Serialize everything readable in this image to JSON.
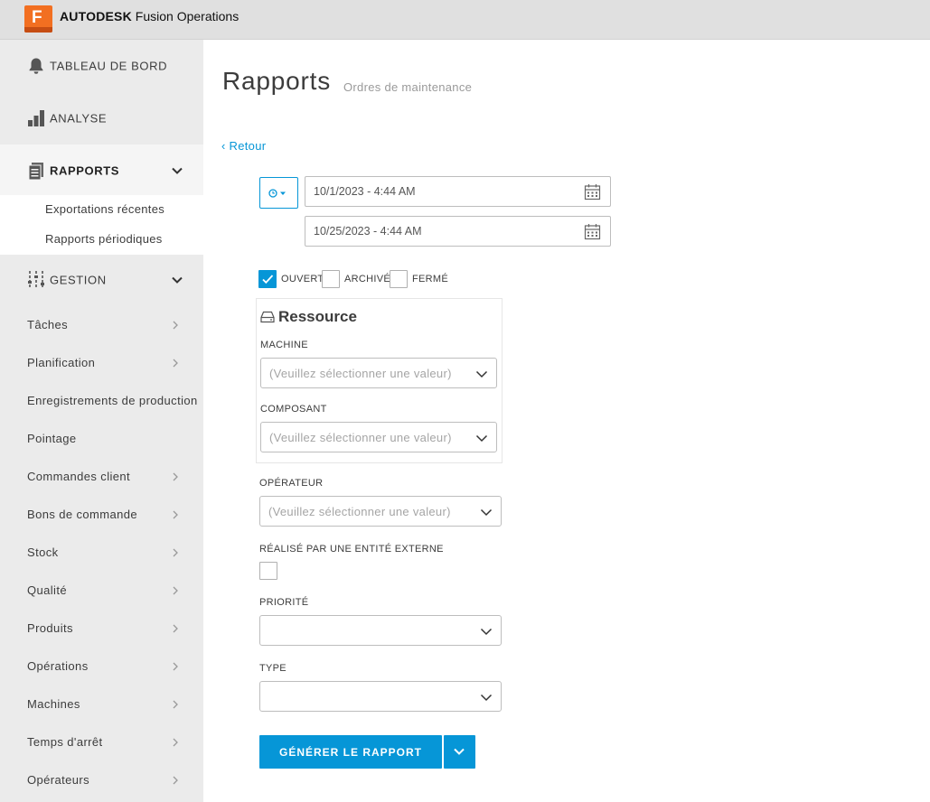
{
  "app": {
    "logo_letter": "F",
    "brand_main": "AUTODESK",
    "brand_sub": "Fusion Operations",
    "accent_color": "#0696d7",
    "logo_color": "#f26f21"
  },
  "sidebar": {
    "main_items": [
      {
        "label": "TABLEAU DE BORD",
        "icon": "bell-icon"
      },
      {
        "label": "ANALYSE",
        "icon": "bar-chart-icon"
      },
      {
        "label": "RAPPORTS",
        "icon": "report-icon",
        "active": true
      },
      {
        "label": "GESTION",
        "icon": "sliders-icon"
      }
    ],
    "report_sub_items": [
      "Exportations récentes",
      "Rapports périodiques"
    ],
    "gestion_items": [
      {
        "label": "Tâches"
      },
      {
        "label": "Planification"
      },
      {
        "label": "Enregistrements de production"
      },
      {
        "label": "Pointage"
      },
      {
        "label": "Commandes client"
      },
      {
        "label": "Bons de commande"
      },
      {
        "label": "Stock"
      },
      {
        "label": "Qualité"
      },
      {
        "label": "Produits"
      },
      {
        "label": "Opérations"
      },
      {
        "label": "Machines"
      },
      {
        "label": "Temps d'arrêt"
      },
      {
        "label": "Opérateurs"
      }
    ]
  },
  "main": {
    "title": "Rapports",
    "subtitle": "Ordres de maintenance",
    "back_label": "‹ Retour",
    "date_start": "10/1/2023 - 4:44 AM",
    "date_end": "10/25/2023 - 4:44 AM",
    "status_filters": [
      {
        "label": "OUVERT",
        "checked": true
      },
      {
        "label": "ARCHIVÉ",
        "checked": false
      },
      {
        "label": "FERMÉ",
        "checked": false
      }
    ],
    "resource": {
      "title": "Ressource",
      "machine_label": "MACHINE",
      "machine_placeholder": "(Veuillez sélectionner une valeur)",
      "component_label": "COMPOSANT",
      "component_placeholder": "(Veuillez sélectionner une valeur)"
    },
    "operator_label": "OPÉRATEUR",
    "operator_placeholder": "(Veuillez sélectionner une valeur)",
    "external_label": "RÉALISÉ PAR UNE ENTITÉ EXTERNE",
    "external_checked": false,
    "priority_label": "PRIORITÉ",
    "priority_value": "",
    "type_label": "TYPE",
    "type_value": "",
    "generate_label": "GÉNÉRER LE RAPPORT"
  }
}
